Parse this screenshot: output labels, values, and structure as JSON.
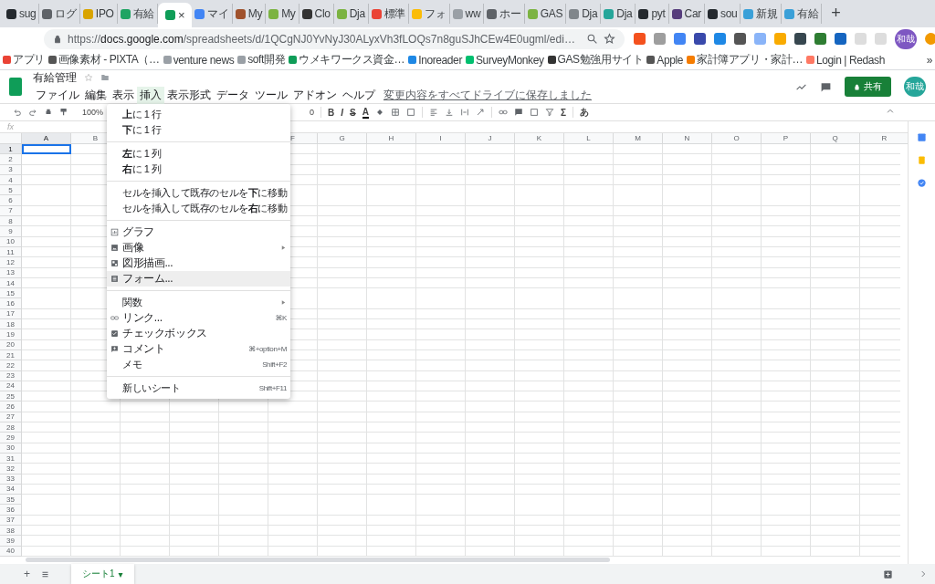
{
  "browser": {
    "tabs": [
      {
        "label": "sug",
        "selected": false,
        "color": "#24292e"
      },
      {
        "label": "ログ",
        "selected": false,
        "color": "#5f6368"
      },
      {
        "label": "IPO",
        "selected": false,
        "color": "#d9a400"
      },
      {
        "label": "有給",
        "selected": false,
        "color": "#1fa463"
      },
      {
        "selected": true,
        "color": "#0f9d58",
        "close": "×"
      },
      {
        "label": "マイ",
        "selected": false,
        "color": "#4285f4"
      },
      {
        "label": "My",
        "selected": false,
        "color": "#a0522d"
      },
      {
        "label": "My",
        "selected": false,
        "color": "#7cb342"
      },
      {
        "label": "Clo",
        "selected": false,
        "color": "#333333"
      },
      {
        "label": "Dja",
        "selected": false,
        "color": "#7cb342"
      },
      {
        "label": "標準",
        "selected": false,
        "color": "#ea4335"
      },
      {
        "label": "フォ",
        "selected": false,
        "color": "#fbbc05"
      },
      {
        "label": "ww",
        "selected": false,
        "color": "#9aa0a6"
      },
      {
        "label": "ホー",
        "selected": false,
        "color": "#5f6368"
      },
      {
        "label": "GAS",
        "selected": false,
        "color": "#7cb342"
      },
      {
        "label": "Dja",
        "selected": false,
        "color": "#80868b"
      },
      {
        "label": "Dja",
        "selected": false,
        "color": "#26a69a"
      },
      {
        "label": "pyt",
        "selected": false,
        "color": "#24292e"
      },
      {
        "label": "Car",
        "selected": false,
        "color": "#563d7c"
      },
      {
        "label": "sou",
        "selected": false,
        "color": "#24292e"
      },
      {
        "label": "新規",
        "selected": false,
        "color": "#3aa0d8"
      },
      {
        "label": "有給",
        "selected": false,
        "color": "#3aa0d8"
      }
    ],
    "new_tab": "+",
    "url": {
      "scheme": "https://",
      "host": "docs.google.com",
      "path": "/spreadsheets/d/1QCgNJ0YvNyJ30ALyxVh3fLOQs7n8guSJhCEw4E0ugml/edi…"
    },
    "avatar": "和哉",
    "bookmarks": [
      {
        "label": "アプリ",
        "color": "#ea4335"
      },
      {
        "label": "画像素材 - PIXTA（…",
        "color": "#555555"
      },
      {
        "label": "venture news",
        "color": "#9aa0a6"
      },
      {
        "label": "soft開発",
        "color": "#9aa0a6"
      },
      {
        "label": "ウメキワークス資金…",
        "color": "#0f9d58"
      },
      {
        "label": "Inoreader",
        "color": "#1e88e5"
      },
      {
        "label": "SurveyMonkey",
        "color": "#00bf6f"
      },
      {
        "label": "GAS勉強用サイト",
        "color": "#333333"
      },
      {
        "label": "Apple",
        "color": "#555555"
      },
      {
        "label": "家計簿アプリ・家計…",
        "color": "#f57c00"
      },
      {
        "label": "Login | Redash",
        "color": "#ff7964"
      }
    ],
    "more": "»"
  },
  "sheets": {
    "title": "有給管理",
    "menus": [
      {
        "label": "ファイル",
        "selected": false
      },
      {
        "label": "編集",
        "selected": false
      },
      {
        "label": "表示",
        "selected": false
      },
      {
        "label": "挿入",
        "selected": true
      },
      {
        "label": "表示形式",
        "selected": false
      },
      {
        "label": "データ",
        "selected": false
      },
      {
        "label": "ツール",
        "selected": false
      },
      {
        "label": "アドオン",
        "selected": false
      },
      {
        "label": "ヘルプ",
        "selected": false
      }
    ],
    "save_status": "変更内容をすべてドライブに保存しました",
    "share": "共有",
    "avatar": "和哉",
    "toolbar": {
      "zoom": "100%",
      "font_size": "0",
      "bold": "B",
      "italic": "I",
      "strike": "S",
      "text_color": "A",
      "functions": "Σ",
      "input_tools": "あ"
    },
    "formula_label": "fx",
    "columns": [
      {
        "label": "A",
        "selected": true
      },
      {
        "label": "B",
        "selected": false
      },
      {},
      {},
      {},
      {
        "label": "F",
        "selected": false
      },
      {
        "label": "G",
        "selected": false
      },
      {
        "label": "H",
        "selected": false
      },
      {
        "label": "I",
        "selected": false
      },
      {
        "label": "J",
        "selected": false
      },
      {
        "label": "K",
        "selected": false
      },
      {
        "label": "L",
        "selected": false
      },
      {
        "label": "M",
        "selected": false
      },
      {
        "label": "N",
        "selected": false
      },
      {
        "label": "O",
        "selected": false
      },
      {
        "label": "P",
        "selected": false
      },
      {
        "label": "Q",
        "selected": false
      },
      {
        "label": "R",
        "selected": false
      }
    ],
    "rows": [
      {
        "label": "1",
        "selected": true
      },
      {
        "label": "2",
        "selected": false
      },
      {
        "label": "3",
        "selected": false
      },
      {
        "label": "4",
        "selected": false
      },
      {
        "label": "5",
        "selected": false
      },
      {
        "label": "6",
        "selected": false
      },
      {
        "label": "7",
        "selected": false
      },
      {
        "label": "8",
        "selected": false
      },
      {
        "label": "9",
        "selected": false
      },
      {
        "label": "10",
        "selected": false
      },
      {
        "label": "11",
        "selected": false
      },
      {
        "label": "12",
        "selected": false
      },
      {
        "label": "13",
        "selected": false
      },
      {
        "label": "14",
        "selected": false
      },
      {
        "label": "15",
        "selected": false
      },
      {
        "label": "16",
        "selected": false
      },
      {
        "label": "17",
        "selected": false
      },
      {
        "label": "18",
        "selected": false
      },
      {
        "label": "19",
        "selected": false
      },
      {
        "label": "20",
        "selected": false
      },
      {
        "label": "21",
        "selected": false
      },
      {
        "label": "22",
        "selected": false
      },
      {
        "label": "23",
        "selected": false
      },
      {
        "label": "24",
        "selected": false
      },
      {
        "label": "25",
        "selected": false
      },
      {
        "label": "26",
        "selected": false
      },
      {
        "label": "27",
        "selected": false
      },
      {
        "label": "28",
        "selected": false
      },
      {
        "label": "29",
        "selected": false
      },
      {
        "label": "30",
        "selected": false
      },
      {
        "label": "31",
        "selected": false
      },
      {
        "label": "32",
        "selected": false
      },
      {
        "label": "33",
        "selected": false
      },
      {
        "label": "34",
        "selected": false
      },
      {
        "label": "35",
        "selected": false
      },
      {
        "label": "36",
        "selected": false
      },
      {
        "label": "37",
        "selected": false
      },
      {
        "label": "38",
        "selected": false
      },
      {
        "label": "39",
        "selected": false
      },
      {
        "label": "40",
        "selected": false
      }
    ],
    "insert_menu": [
      [
        {
          "kind": "plain",
          "label": "**上**に 1 行",
          "selected": false
        },
        {
          "kind": "plain",
          "label": "**下**に 1 行",
          "selected": false
        }
      ],
      [
        {
          "kind": "plain",
          "label": "**左**に 1 列",
          "selected": false
        },
        {
          "kind": "plain",
          "label": "**右**に 1 列",
          "selected": false
        }
      ],
      [
        {
          "kind": "plain",
          "label": "セルを挿入して既存のセルを**下**に移動",
          "selected": false
        },
        {
          "kind": "plain",
          "label": "セルを挿入して既存のセルを**右**に移動",
          "selected": false
        }
      ],
      [
        {
          "kind": "chart",
          "label": "グラフ",
          "selected": false
        },
        {
          "kind": "image",
          "label": "画像",
          "submenu": true,
          "selected": false
        },
        {
          "kind": "drawing",
          "label": "図形描画...",
          "selected": false
        },
        {
          "kind": "form",
          "label": "フォーム...",
          "selected": true
        }
      ],
      [
        {
          "kind": "plain",
          "label": "関数",
          "submenu": true,
          "selected": false
        },
        {
          "kind": "link",
          "label": "リンク...",
          "shortcut": "⌘K",
          "selected": false
        },
        {
          "kind": "checkbox",
          "label": "チェックボックス",
          "selected": false
        },
        {
          "kind": "comment",
          "label": "コメント",
          "shortcut": "⌘+option+M",
          "selected": false
        },
        {
          "kind": "plain",
          "label": "メモ",
          "shortcut": "Shift+F2",
          "selected": false
        }
      ],
      [
        {
          "kind": "plain",
          "label": "新しいシート",
          "shortcut": "Shift+F11",
          "selected": false
        }
      ]
    ],
    "add_sheet": "+",
    "sheet_tabs": [
      {
        "label": "シート1",
        "selected": true
      }
    ],
    "tab_caret": "▾"
  }
}
